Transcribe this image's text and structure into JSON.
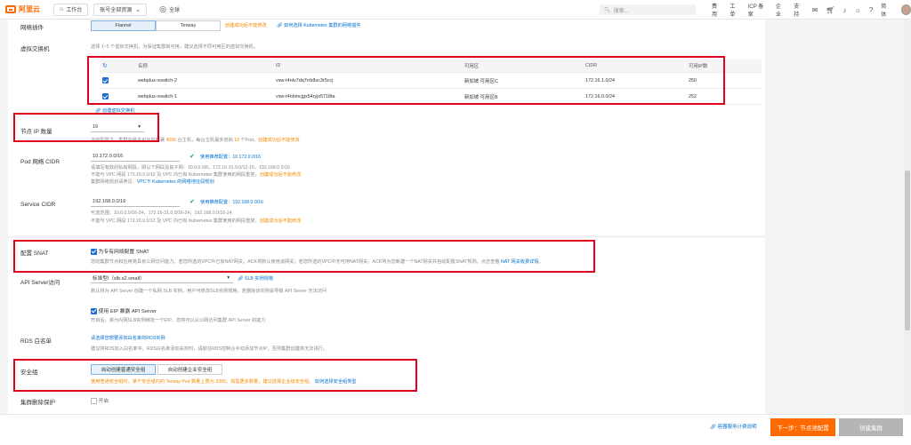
{
  "topbar": {
    "logo_text": "阿里云",
    "workbench": "工作台",
    "resource_group": "账号全部资源",
    "region": "全球",
    "search_placeholder": "搜索...",
    "links": [
      "费用",
      "工单",
      "ICP 备案",
      "企业",
      "支持"
    ],
    "lang": "简体",
    "icons": [
      "message-icon",
      "cart-icon",
      "bell-icon",
      "bulb-icon",
      "help-icon"
    ]
  },
  "network_plugin": {
    "label": "网络插件",
    "options": [
      "Flannel",
      "Terway"
    ],
    "selected": "Flannel",
    "warn": "创建成功后不能修改",
    "link": "如何选择 Kubernetes 集群的网络插件"
  },
  "vswitch": {
    "label": "虚拟交换机",
    "hint": "选择 1~5 个虚拟交换机。为保证集群高可用，建议选择不同可用区的虚拟交换机。",
    "columns": [
      "",
      "名称",
      "ID",
      "可用区",
      "CIDR",
      "可用IP数"
    ],
    "rows": [
      {
        "name": "webplus-vswitch-2",
        "id": "vsw-t4ntv7dq7rrb8uc3r5ccj",
        "zone": "新加坡 可用区C",
        "cidr": "172.16.1.0/24",
        "ips": "250"
      },
      {
        "name": "webplus-vswitch-1",
        "id": "vsw-t4nbmcjgx54ryjx5718ta",
        "zone": "新加坡 可用区B",
        "cidr": "172.16.0.0/24",
        "ips": "252"
      }
    ],
    "create_link": "创建虚拟交换机"
  },
  "node_ip": {
    "label": "节点 IP 数量",
    "value": "16",
    "hint_a": "当前配置下，集群内最多可允许部署",
    "hint_num1": "4096",
    "hint_b": "台主机，每台主机最多容纳",
    "hint_num2": "16",
    "hint_c": "个Pod。",
    "warn": "创建成功后不能修改"
  },
  "pod_cidr": {
    "label": "Pod 网络 CIDR",
    "value": "10.172.0.0/16",
    "recommend": "使用推荐配置：10.172.0.0/16",
    "hint1": "请填写有效的私有网段，即以下网段及其子网：10.0.0.0/8，172.16-31.0.0/12-16，192.168.0.0/16",
    "hint2a": "不能与 VPC 网段 172.16.0.0/12 及 VPC 内已有 Kubernetes 集群使用的网段重复，",
    "hint2b": "创建成功后不能修改",
    "hint3a": "集群网络规划请参见：",
    "hint3b": "VPC下 Kubernetes 的网络地址段规划"
  },
  "service_cidr": {
    "label": "Service CIDR",
    "value": "192.168.0.0/16",
    "recommend": "使用推荐配置：192.168.0.0/16",
    "hint1": "可选范围：10.0.0.0/16-24，172.16-31.0.0/16-24，192.168.0.0/16-24",
    "hint2a": "不能与 VPC 网段 172.16.0.0/12 及 VPC 内已有 Kubernetes 集群使用的网段重复，",
    "hint2b": "创建成功后不能修改"
  },
  "snat": {
    "label": "配置 SNAT",
    "checkbox_label": "为专有网络配置 SNAT",
    "hint_a": "您的集群节点和应用将具有公网访问能力。若您所选的VPC中已有NAT网关，ACK将默认使用该网关；若您所选的VPC中无可用NAT网关，ACK将为您新建一个NAT网关并自动配置SNAT规则。点击查看",
    "hint_link": "NAT 网关收费详情",
    "hint_end": "。"
  },
  "api_server": {
    "label": "API Server访问",
    "select_value": "标准型I（slb.s2.small）",
    "spec_link": "SLB 实例规格",
    "hint": "默认将为 API Server 创建一个私网 SLB 实例，用户可修改SLB实例规格。若删除该实例会导致 API Server 无法访问",
    "eip_label": "使用 EIP 暴露 API Server",
    "eip_hint": "开启后，将为内网SLB实例绑定一个EIP，您将可以从公网访问集群 API Server 的能力"
  },
  "rds": {
    "label": "RDS 白名单",
    "link": "请选择您想要添加白名单的RDS实例",
    "hint": "建议将RDS加入白名单中，RDS白名单添加失败时，请前往RDS控制台手动添加节点IP，否则集群创建将无法进行。"
  },
  "security_group": {
    "label": "安全组",
    "options": [
      "自动创建普通安全组",
      "自动创建企业安全组"
    ],
    "selected": "自动创建普通安全组",
    "warn": "使用普通安全组时，单个安全组内的 Terway Pod 数量上限为 2000。如需更多数量，建议选择企业级安全组。",
    "link": "如何选择安全组类型"
  },
  "delete_protect": {
    "label": "集群删除保护",
    "checkbox_label": "开启"
  },
  "footer": {
    "quota_link": "容器服务计费说明",
    "next_button": "下一步：节点池配置",
    "create_button": "创建集群"
  },
  "colors": {
    "accent": "#ff6a00",
    "link": "#0070cc",
    "warn": "#f28b00",
    "highlight": "#e0001b"
  }
}
